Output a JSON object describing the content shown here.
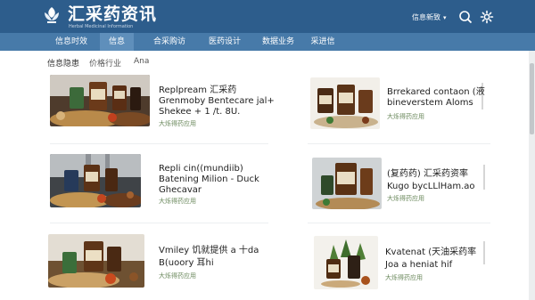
{
  "header": {
    "brand_title": "汇采药资讯",
    "brand_subtitle": "Herbal Medicinal Information",
    "user_menu_label": "信息新致",
    "colors": {
      "topbar": "#2d5d8c",
      "navbar": "#477aa9",
      "nav_active": "#5f8fbb",
      "meta_text": "#6c8a5e"
    },
    "icons": [
      "logo-leaf-icon",
      "chevron-down-icon",
      "search-icon",
      "settings-icon"
    ]
  },
  "nav": {
    "items": [
      {
        "label": "信息时效"
      },
      {
        "label": "信息"
      },
      {
        "label": "合采购访"
      },
      {
        "label": "医药设计"
      },
      {
        "label": "数据业务"
      },
      {
        "label": "采进信"
      }
    ]
  },
  "subnav": {
    "items": [
      {
        "label": "信息隐患"
      },
      {
        "label": "价格行业"
      },
      {
        "label": "Ana"
      }
    ]
  },
  "articles": [
    {
      "title_line1": "Replpream 汇采药",
      "title_line2": "Grenmoby Bentecare jal+",
      "title_line3": "Shekee + 1 /t. 8U.",
      "meta": "大烁得药应用"
    },
    {
      "title_line1": "Brrekared contaon (液",
      "title_line2": "bineverstem Aloms",
      "title_line3": "",
      "meta": "大烁得药应用"
    },
    {
      "title_line1": "Repli cin((mundiib)",
      "title_line2": "Batening  Milion - Duck",
      "title_line3": "Ghecavar",
      "meta": "大烁得药应用"
    },
    {
      "title_line1": "(复药药) 汇采药资率",
      "title_line2": "Kugo bycLLlHam.ao",
      "title_line3": "",
      "meta": "大烁得药应用"
    },
    {
      "title_line1": "Vmiley 饥就提供 a 十da",
      "title_line2": "B(uoory 耳hi",
      "title_line3": "",
      "meta": "大烁得药应用"
    },
    {
      "title_line1": "Kvatenat (天油采药率",
      "title_line2": "Joa a heniat hif",
      "title_line3": "",
      "meta": "大烁得药应用"
    }
  ]
}
